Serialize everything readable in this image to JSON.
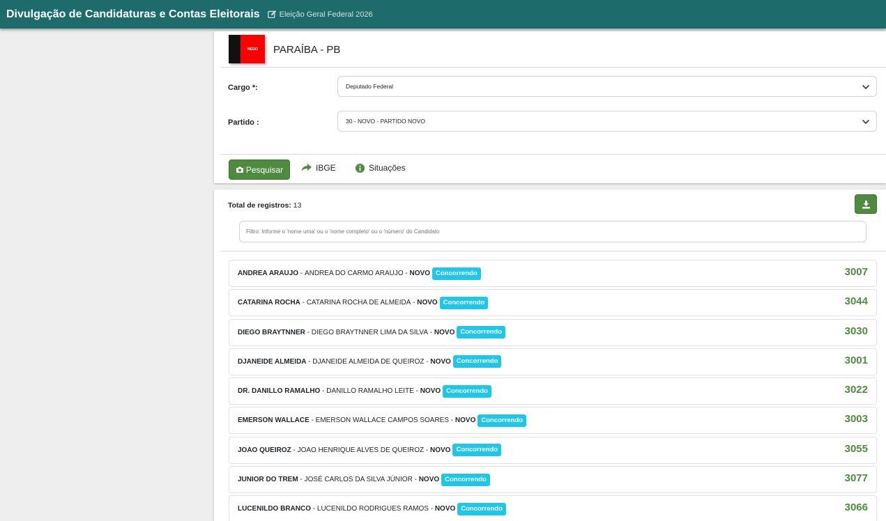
{
  "header": {
    "title": "Divulgação de Candidaturas e Contas Eleitorais",
    "election": "Eleição Geral Federal 2026"
  },
  "state": {
    "flag_text": "NEGO",
    "name": "PARAÍBA - PB"
  },
  "form": {
    "cargo_label": "Cargo *:",
    "cargo_value": "Deputado Federal",
    "partido_label": "Partido :",
    "partido_value": "30 - NOVO - PARTIDO NOVO"
  },
  "actions": {
    "pesquisar": "Pesquisar",
    "ibge": "IBGE",
    "situacoes": "Situações"
  },
  "results": {
    "total_label": "Total de registros:",
    "total_value": "13",
    "filter_placeholder": "Filtro: Informe o 'nome urna' ou o 'nome completo' ou o 'número' do Candidato",
    "candidates": [
      {
        "nome_urna": "ANDREA ARAUJO",
        "nome_completo": "ANDREA DO CARMO ARAUJO",
        "partido": "NOVO",
        "situacao": "Concorrendo",
        "numero": "3007"
      },
      {
        "nome_urna": "CATARINA ROCHA",
        "nome_completo": "CATARINA ROCHA DE ALMEIDA",
        "partido": "NOVO",
        "situacao": "Concorrendo",
        "numero": "3044"
      },
      {
        "nome_urna": "DIEGO BRAYTNNER",
        "nome_completo": "DIEGO BRAYTNNER LIMA DA SILVA",
        "partido": "NOVO",
        "situacao": "Concorrendo",
        "numero": "3030"
      },
      {
        "nome_urna": "DJANEIDE ALMEIDA",
        "nome_completo": "DJANEIDE ALMEIDA DE QUEIROZ",
        "partido": "NOVO",
        "situacao": "Concorrendo",
        "numero": "3001"
      },
      {
        "nome_urna": "DR. DANILLO RAMALHO",
        "nome_completo": "DANILLO RAMALHO LEITE",
        "partido": "NOVO",
        "situacao": "Concorrendo",
        "numero": "3022"
      },
      {
        "nome_urna": "EMERSON WALLACE",
        "nome_completo": "EMERSON WALLACE CAMPOS SOARES",
        "partido": "NOVO",
        "situacao": "Concorrendo",
        "numero": "3003"
      },
      {
        "nome_urna": "JOAO QUEIROZ",
        "nome_completo": "JOAO HENRIQUE ALVES DE QUEIROZ",
        "partido": "NOVO",
        "situacao": "Concorrendo",
        "numero": "3055"
      },
      {
        "nome_urna": "JUNIOR DO TREM",
        "nome_completo": "JOSÉ CARLOS DA SILVA JÚNIOR",
        "partido": "NOVO",
        "situacao": "Concorrendo",
        "numero": "3077"
      },
      {
        "nome_urna": "LUCENILDO BRANCO",
        "nome_completo": "LUCENILDO RODRIGUES RAMOS",
        "partido": "NOVO",
        "situacao": "Concorrendo",
        "numero": "3066"
      }
    ]
  },
  "colors": {
    "topbar": "#1e6b6b",
    "accent_green": "#4f8b3f",
    "badge": "#1ec7e8"
  },
  "icons": {
    "edit": "edit-icon",
    "camera": "camera-icon",
    "share": "share-icon",
    "info": "info-icon",
    "download": "download-icon",
    "chevron": "chevron-down-icon"
  }
}
